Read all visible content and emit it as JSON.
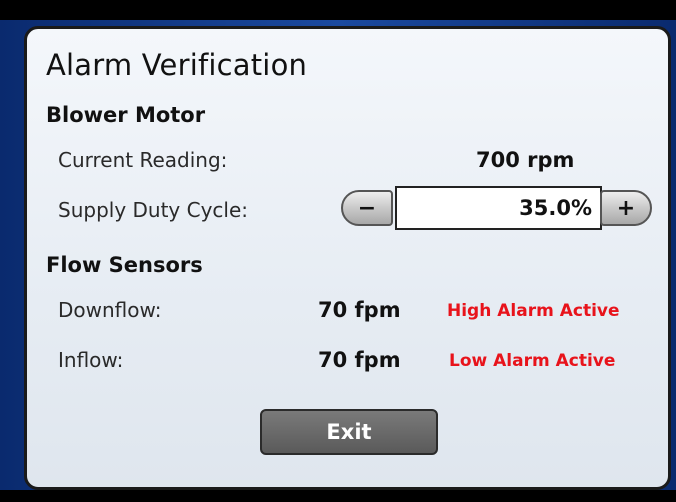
{
  "title": "Alarm Verification",
  "blower": {
    "heading": "Blower Motor",
    "current_label": "Current Reading:",
    "current_value": "700 rpm",
    "duty_label": "Supply Duty Cycle:",
    "duty_value": "35.0%",
    "minus": "−",
    "plus": "+"
  },
  "flow": {
    "heading": "Flow Sensors",
    "downflow_label": "Downflow:",
    "downflow_value": "70 fpm",
    "downflow_alarm": "High Alarm Active",
    "inflow_label": "Inflow:",
    "inflow_value": "70 fpm",
    "inflow_alarm": "Low Alarm Active"
  },
  "exit_label": "Exit",
  "colors": {
    "alarm": "#e8131b",
    "frame_blue": "#1b4aa0"
  }
}
